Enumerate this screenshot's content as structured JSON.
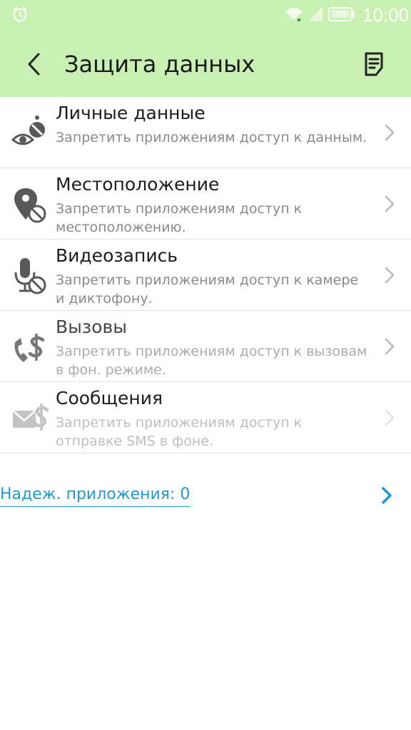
{
  "status_bar": {
    "time": "10:00",
    "battery": "38",
    "icons": [
      "alarm-icon",
      "wifi-icon",
      "signal-icon",
      "battery-icon"
    ]
  },
  "header": {
    "title": "Защита данных",
    "background": "#c9f0b3",
    "back_icon": "back-arrow-icon",
    "action_icon": "notes-icon"
  },
  "items": [
    {
      "title": "Личные данные",
      "desc": "Запретить приложениям доступ к данным.",
      "icon": "privacy-eye-icon"
    },
    {
      "title": "Местоположение",
      "desc": "Запретить приложениям доступ к местоположению.",
      "icon": "location-block-icon"
    },
    {
      "title": "Видеозапись",
      "desc": "Запретить приложениям доступ к камере и диктофону.",
      "icon": "microphone-block-icon"
    },
    {
      "title": "Вызовы",
      "desc": "Запретить приложениям доступ к вызовам в фон. режиме.",
      "icon": "call-cost-icon"
    },
    {
      "title": "Сообщения",
      "desc": "Запретить приложениям доступ к отправке SMS в фоне.",
      "icon": "sms-cost-icon"
    }
  ],
  "trusted_apps": {
    "label": "Надеж. приложения: 0",
    "color": "#1f9ad1"
  },
  "colors": {
    "accent": "#1f9ad1",
    "title_text": "#1c1c1c",
    "secondary_text": "#8a8a8a"
  }
}
